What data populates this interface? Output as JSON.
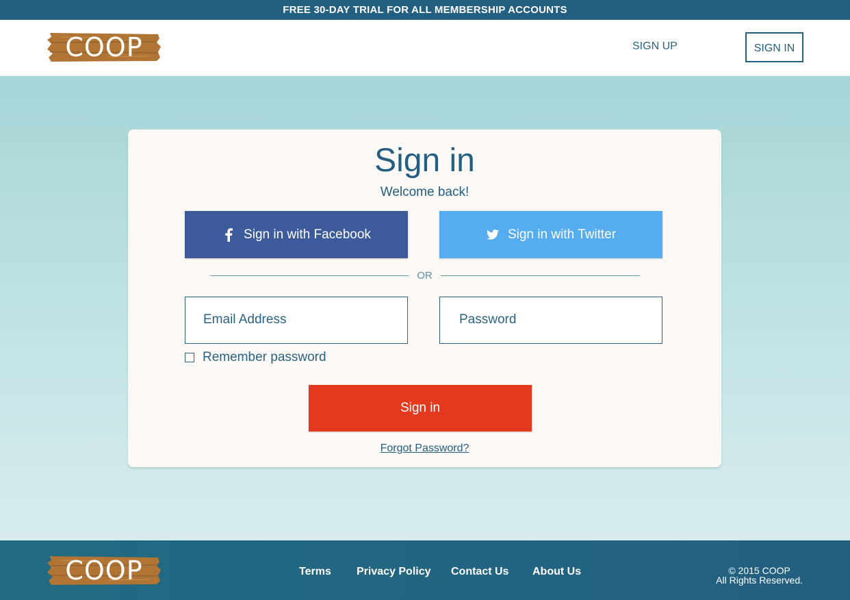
{
  "promo": {
    "text": "FREE 30-DAY TRIAL FOR ALL MEMBERSHIP ACCOUNTS"
  },
  "brand": {
    "name": "COOP"
  },
  "nav": {
    "signup": "SIGN UP",
    "signin": "SIGN IN"
  },
  "card": {
    "title": "Sign in",
    "subtitle": "Welcome back!",
    "facebook_label": "Sign in with Facebook",
    "twitter_label": "Sign in with Twitter",
    "or_text": "OR",
    "email_placeholder": "Email Address",
    "password_placeholder": "Password",
    "remember_label": "Remember password",
    "remember_checked": false,
    "signin_button": "Sign in",
    "forgot_link": "Forgot Password?"
  },
  "footer": {
    "links": [
      "Terms",
      "Privacy Policy",
      "Contact Us",
      "About Us"
    ],
    "copyright_line1": "© 2015 COOP",
    "copyright_line2": "All Rights Reserved."
  },
  "colors": {
    "primary": "#235f80",
    "facebook": "#3d5a9a",
    "twitter": "#55acee",
    "accent_red": "#e5391f",
    "wood": "#b07435"
  }
}
